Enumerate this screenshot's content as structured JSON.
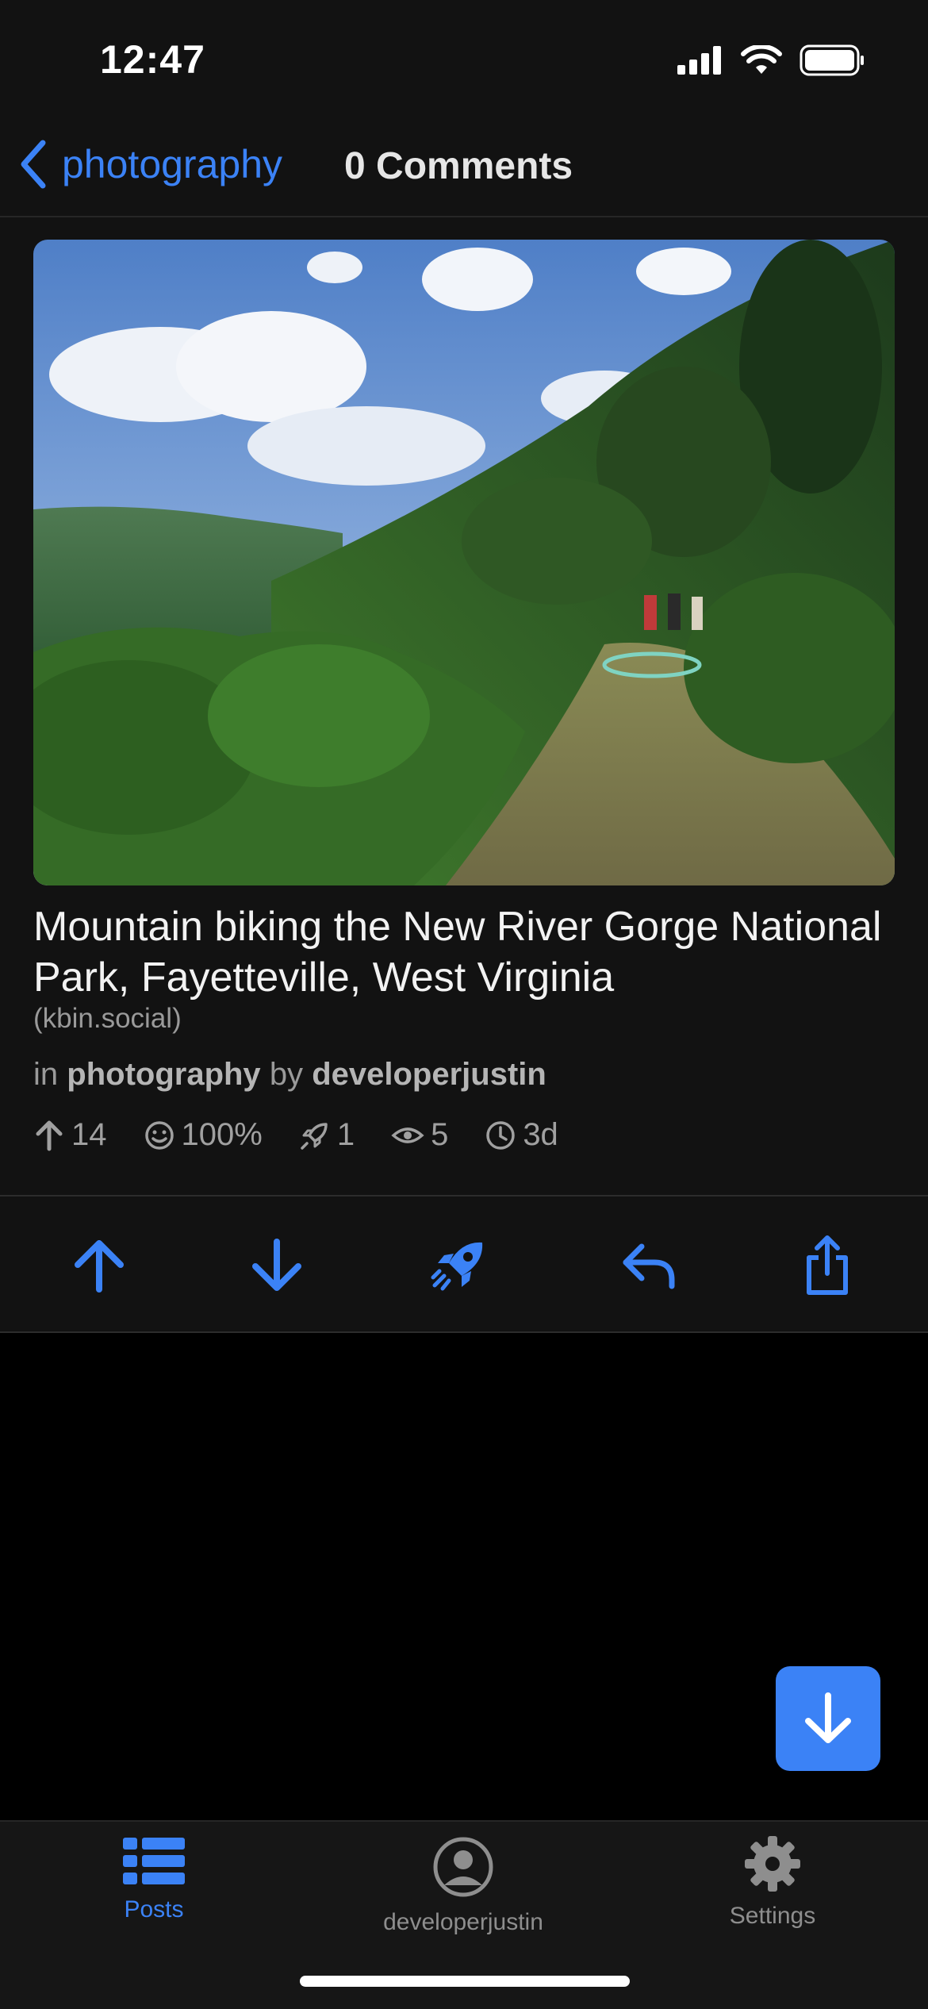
{
  "status_bar": {
    "time": "12:47"
  },
  "nav": {
    "back_label": "photography",
    "title": "0 Comments"
  },
  "post": {
    "title": "Mountain biking the New River Gorge National Park, Fayetteville, West Virginia",
    "domain": "(kbin.social)",
    "meta_in": "in",
    "magazine": "photography",
    "meta_by": "by",
    "author": "developerjustin",
    "stats": {
      "upvotes": "14",
      "approval": "100%",
      "boosts": "1",
      "views": "5",
      "age": "3d"
    }
  },
  "actions": [
    "upvote-icon",
    "downvote-icon",
    "boost-icon",
    "reply-icon",
    "share-icon"
  ],
  "tabs": [
    {
      "label": "Posts",
      "icon": "list-icon",
      "active": true
    },
    {
      "label": "developerjustin",
      "icon": "profile-icon",
      "active": false
    },
    {
      "label": "Settings",
      "icon": "gear-icon",
      "active": false
    }
  ],
  "colors": {
    "accent": "#3b82f6",
    "surface": "#121212",
    "background": "#000000"
  }
}
